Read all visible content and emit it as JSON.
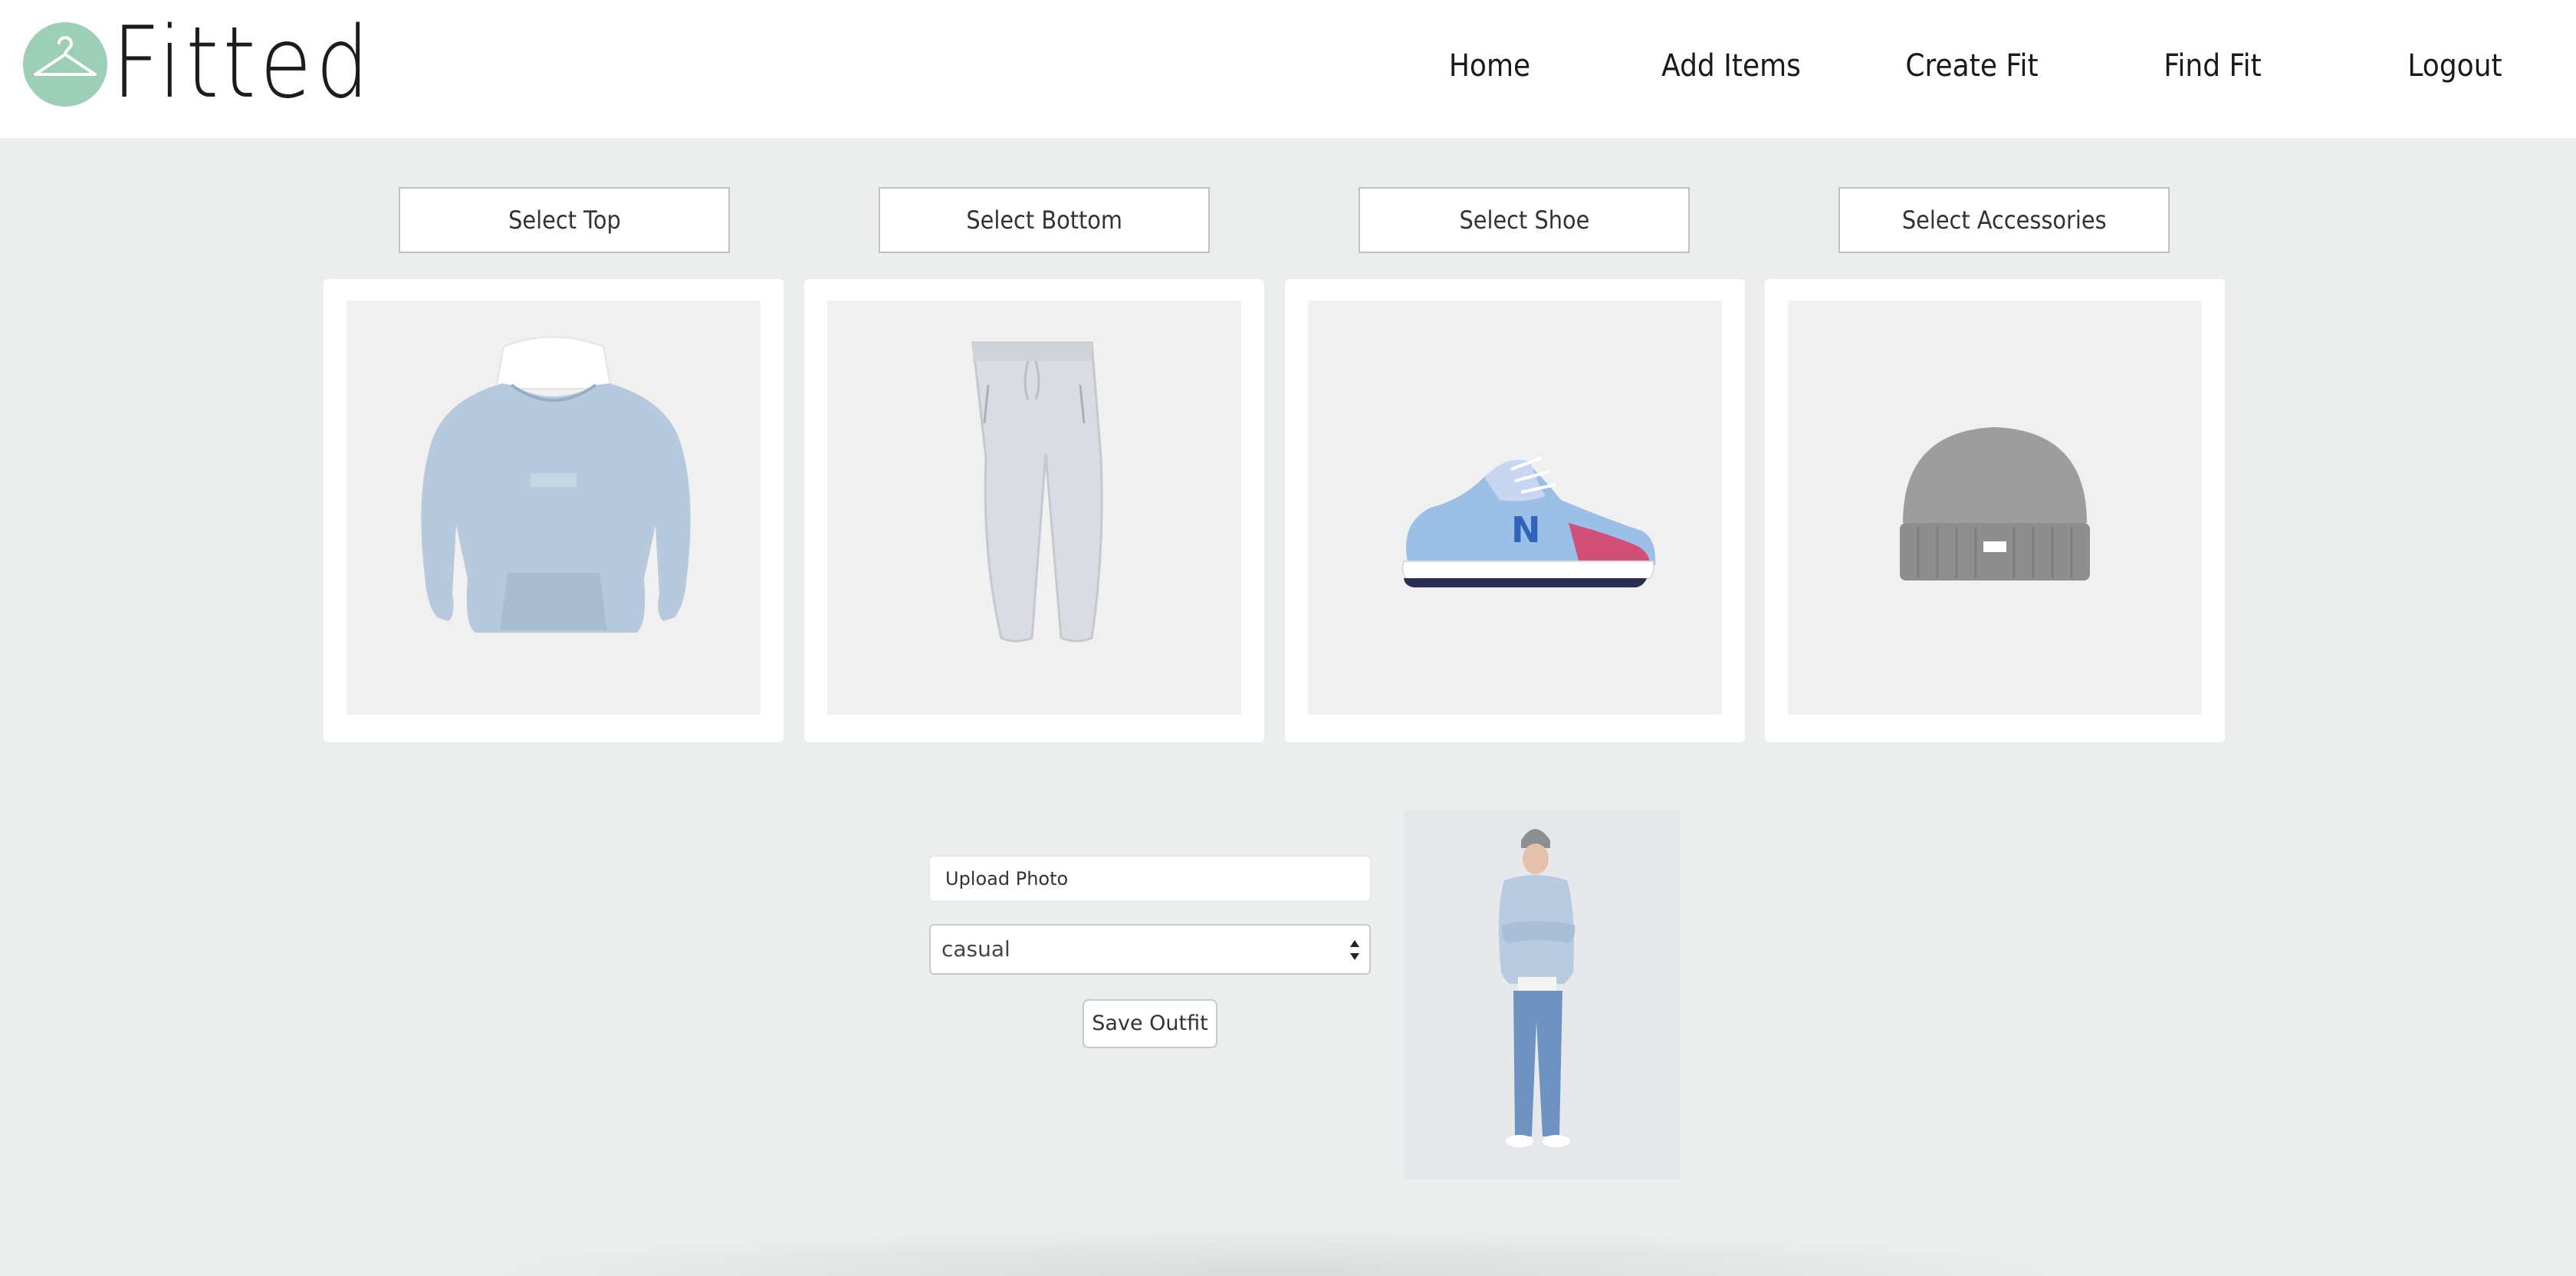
{
  "brand": {
    "name": "Fitted",
    "logo_icon": "hanger-icon",
    "logo_color": "#9ccfb6"
  },
  "nav": {
    "home": "Home",
    "add_items": "Add Items",
    "create_fit": "Create Fit",
    "find_fit": "Find Fit",
    "logout": "Logout"
  },
  "selectors": {
    "top": "Select Top",
    "bottom": "Select Bottom",
    "shoe": "Select Shoe",
    "accessories": "Select Accessories"
  },
  "items": [
    {
      "slot": "top",
      "image": "light-blue-hoodie"
    },
    {
      "slot": "bottom",
      "image": "grey-sweatpants"
    },
    {
      "slot": "shoe",
      "image": "blue-pink-sneaker"
    },
    {
      "slot": "accessories",
      "image": "grey-beanie"
    }
  ],
  "form": {
    "upload_label": "Upload Photo",
    "category_value": "casual",
    "save_label": "Save Outfit"
  },
  "outfit_photo": {
    "image": "model-wearing-outfit"
  },
  "colors": {
    "page_bg": "#ebeeed",
    "header_bg": "#ffffff",
    "card_bg": "#ffffff"
  }
}
